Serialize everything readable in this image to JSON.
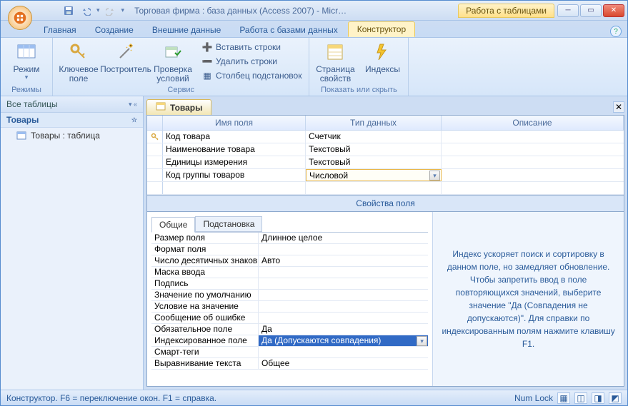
{
  "title": "Торговая фирма : база данных (Access 2007) - Micr…",
  "contextual_title": "Работа с таблицами",
  "tabs": {
    "home": "Главная",
    "create": "Создание",
    "external": "Внешние данные",
    "dbtools": "Работа с базами данных",
    "designer": "Конструктор"
  },
  "ribbon": {
    "modes_group": "Режимы",
    "mode": "Режим",
    "service_group": "Сервис",
    "key_field": "Ключевое поле",
    "builder": "Построитель",
    "check": "Проверка условий",
    "ins_rows": "Вставить строки",
    "del_rows": "Удалить строки",
    "lookup_col": "Столбец подстановок",
    "show_hide_group": "Показать или скрыть",
    "prop_sheet": "Страница свойств",
    "indexes": "Индексы"
  },
  "nav": {
    "header": "Все таблицы",
    "group": "Товары",
    "item1": "Товары : таблица"
  },
  "doc": {
    "tab": "Товары",
    "col_name": "Имя поля",
    "col_type": "Тип данных",
    "col_desc": "Описание",
    "rows": [
      {
        "name": "Код товара",
        "type": "Счетчик",
        "pk": true
      },
      {
        "name": "Наименование товара",
        "type": "Текстовый",
        "pk": false
      },
      {
        "name": "Единицы измерения",
        "type": "Текстовый",
        "pk": false
      },
      {
        "name": "Код группы товаров",
        "type": "Числовой",
        "pk": false
      }
    ]
  },
  "props": {
    "title": "Свойства поля",
    "tab_general": "Общие",
    "tab_lookup": "Подстановка",
    "rows": [
      {
        "n": "Размер поля",
        "v": "Длинное целое"
      },
      {
        "n": "Формат поля",
        "v": ""
      },
      {
        "n": "Число десятичных знаков",
        "v": "Авто"
      },
      {
        "n": "Маска ввода",
        "v": ""
      },
      {
        "n": "Подпись",
        "v": ""
      },
      {
        "n": "Значение по умолчанию",
        "v": ""
      },
      {
        "n": "Условие на значение",
        "v": ""
      },
      {
        "n": "Сообщение об ошибке",
        "v": ""
      },
      {
        "n": "Обязательное поле",
        "v": "Да"
      },
      {
        "n": "Индексированное поле",
        "v": "Да (Допускаются совпадения)"
      },
      {
        "n": "Смарт-теги",
        "v": ""
      },
      {
        "n": "Выравнивание текста",
        "v": "Общее"
      }
    ],
    "help": "Индекс ускоряет поиск и сортировку в данном поле, но замедляет обновление. Чтобы запретить ввод в поле повторяющихся значений, выберите значение \"Да (Совпадения не допускаются)\". Для справки по индексированным полям нажмите клавишу F1."
  },
  "status": {
    "left": "Конструктор.  F6 = переключение окон.  F1 = справка.",
    "numlock": "Num Lock"
  }
}
